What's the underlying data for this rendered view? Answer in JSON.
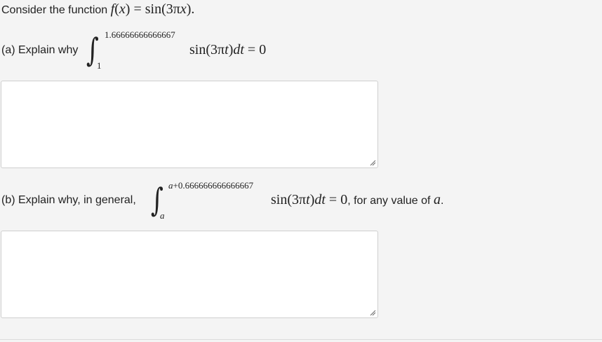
{
  "intro": {
    "text": "Consider the function ",
    "f": "f",
    "x": "x",
    "equals": "=",
    "sin": "sin",
    "three_pi": "3π",
    "period": "."
  },
  "part_a": {
    "label": "(a) Explain why",
    "upper_limit": "1.66666666666667",
    "lower_limit": "1",
    "sin": "sin",
    "three_pi": "3π",
    "t": "t",
    "dt": "dt",
    "equals_zero": "= 0",
    "answer_value": ""
  },
  "part_b": {
    "label": "(b) Explain why, in general,",
    "upper_limit_var": "a",
    "upper_limit_rest": "+0.666666666666667",
    "lower_limit": "a",
    "sin": "sin",
    "three_pi": "3π",
    "t": "t",
    "dt": "dt",
    "equals_zero": "= 0",
    "suffix": ", for any value of ",
    "a_var": "a",
    "period": ".",
    "answer_value": ""
  }
}
